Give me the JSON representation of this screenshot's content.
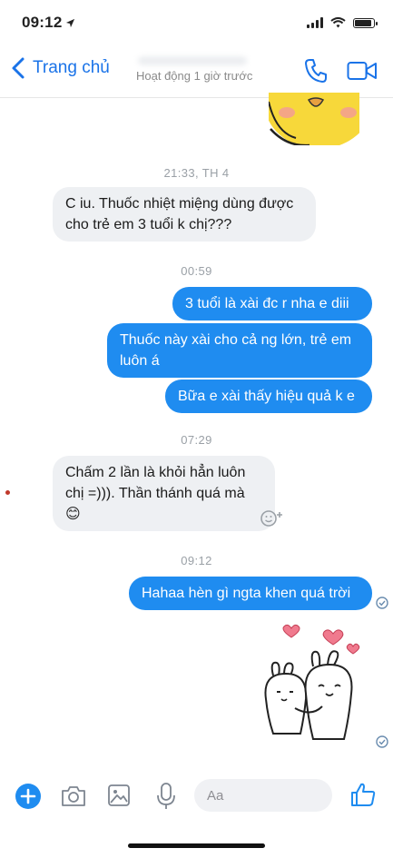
{
  "status_bar": {
    "time": "09:12"
  },
  "header": {
    "back_label": "Trang chủ",
    "status": "Hoạt động 1 giờ trước"
  },
  "composer": {
    "placeholder": "Aa"
  },
  "conversation": {
    "timestamps": [
      "21:33, TH 4",
      "00:59",
      "07:29",
      "09:12"
    ],
    "messages": [
      {
        "side": "in",
        "text": "C iu. Thuốc nhiệt miệng dùng được cho trẻ em 3 tuổi k chị???"
      },
      {
        "side": "out",
        "text": "3 tuổi là xài đc r nha e diii"
      },
      {
        "side": "out",
        "text": "Thuốc này xài cho cả ng lớn, trẻ em luôn á"
      },
      {
        "side": "out",
        "text": "Bữa e xài thấy hiệu quả k e"
      },
      {
        "side": "in",
        "text": "Chấm 2 lần là khỏi hẳn luôn chị =))). Thần thánh quá mà 😊"
      },
      {
        "side": "out",
        "text": "Hahaa hèn gì ngta khen quá trời"
      }
    ]
  },
  "colors": {
    "accent": "#1f8cf0",
    "incoming_bubble": "#eef0f3",
    "nav_blue": "#1a73e8"
  }
}
